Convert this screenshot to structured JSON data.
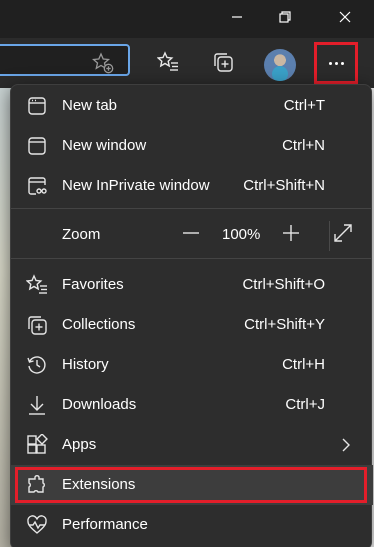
{
  "window_controls": {
    "minimize": "minimize-icon",
    "restore": "restore-icon",
    "close": "close-icon"
  },
  "toolbar": {
    "address_favorite_icon": "add-favorite-icon",
    "buttons": [
      "favorites-icon",
      "collections-icon",
      "profile-avatar",
      "more-icon"
    ],
    "highlight_color": "#e31e2a"
  },
  "menu": {
    "items": [
      {
        "label": "New tab",
        "shortcut": "Ctrl+T",
        "icon": "new-tab-icon"
      },
      {
        "label": "New window",
        "shortcut": "Ctrl+N",
        "icon": "new-window-icon"
      },
      {
        "label": "New InPrivate window",
        "shortcut": "Ctrl+Shift+N",
        "icon": "inprivate-icon"
      },
      {
        "label": "Favorites",
        "shortcut": "Ctrl+Shift+O",
        "icon": "favorites-icon"
      },
      {
        "label": "Collections",
        "shortcut": "Ctrl+Shift+Y",
        "icon": "collections-icon"
      },
      {
        "label": "History",
        "shortcut": "Ctrl+H",
        "icon": "history-icon"
      },
      {
        "label": "Downloads",
        "shortcut": "Ctrl+J",
        "icon": "downloads-icon"
      },
      {
        "label": "Apps",
        "shortcut": "",
        "icon": "apps-icon"
      },
      {
        "label": "Extensions",
        "shortcut": "",
        "icon": "extensions-icon"
      },
      {
        "label": "Performance",
        "shortcut": "",
        "icon": "performance-icon"
      }
    ],
    "zoom": {
      "label": "Zoom",
      "value": "100%",
      "minus_icon": "zoom-out-icon",
      "plus_icon": "zoom-in-icon",
      "fullscreen_icon": "fullscreen-icon"
    },
    "highlighted_item": "Extensions"
  }
}
